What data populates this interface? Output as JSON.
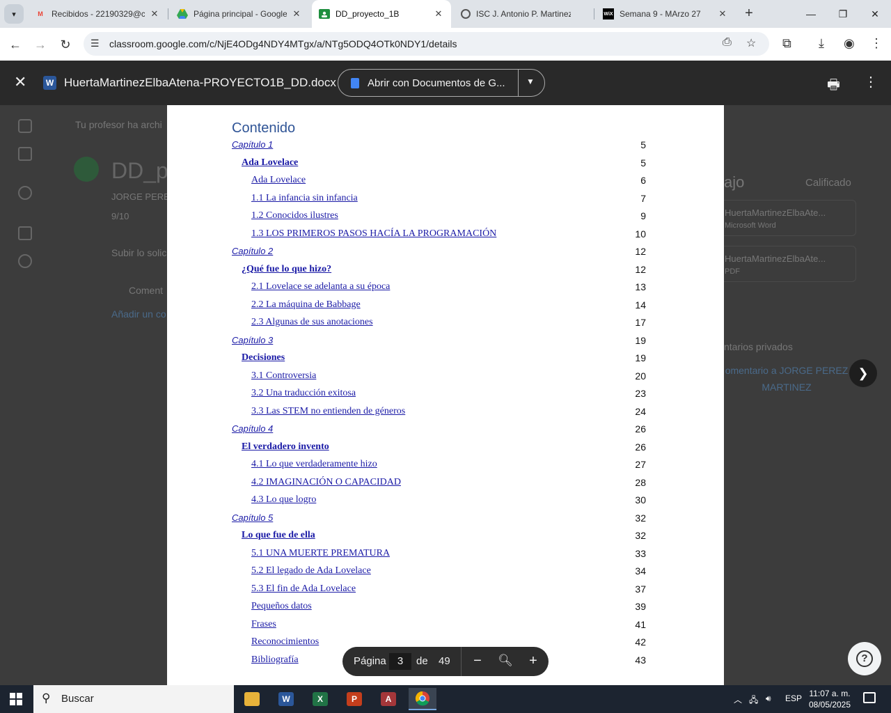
{
  "browser": {
    "tabs": [
      {
        "title": "Recibidos - 22190329@co",
        "icon": "gmail-icon"
      },
      {
        "title": "Página principal - Google",
        "icon": "drive-icon"
      },
      {
        "title": "DD_proyecto_1B",
        "icon": "classroom-icon",
        "active": true
      },
      {
        "title": "ISC J. Antonio P. Martinez",
        "icon": "globe-icon"
      },
      {
        "title": "Semana 9 - MArzo 27",
        "icon": "wix-icon"
      }
    ],
    "url": "classroom.google.com/c/NjE4ODg4NDY4MTgx/a/NTg5ODQ4OTk0NDY1/details"
  },
  "background_page": {
    "notice": "Tu profesor ha archi",
    "assignment_title": "DD_pr",
    "teacher": "JORGE PERE",
    "grade": "9/10",
    "upload_hint": "Subir lo solic",
    "comments_label": "Coment",
    "add_comment": "Añadir un co",
    "work_heading": "ajo",
    "graded_status": "Calificado",
    "files": [
      {
        "name": "HuertaMartinezElbaAte...",
        "type": "Microsoft Word"
      },
      {
        "name": "HuertaMartinezElbaAte...",
        "type": "PDF"
      }
    ],
    "private_comments": "ntarios privados",
    "private_comment_link": "omentario a JORGE PEREZ MARTINEZ"
  },
  "viewer": {
    "filename": "HuertaMartinezElbaAtena-PROYECTO1B_DD.docx",
    "open_with": "Abrir con Documentos de G...",
    "file_icon_letter": "W"
  },
  "document": {
    "toc_title": "Contenido",
    "entries": [
      {
        "text": "Capítulo 1",
        "page": "5",
        "level": "chap"
      },
      {
        "text": "Ada Lovelace",
        "page": "5",
        "level": "title"
      },
      {
        "text": "Ada Lovelace",
        "page": "6",
        "level": "sub"
      },
      {
        "text": "1.1 La infancia sin infancia",
        "page": "7",
        "level": "sub"
      },
      {
        "text": "1.2 Conocidos ilustres",
        "page": "9",
        "level": "sub"
      },
      {
        "text": "1.3 LOS PRIMEROS PASOS HACÍA LA PROGRAMACIÓN",
        "page": "10",
        "level": "sub"
      },
      {
        "text": "Capítulo 2",
        "page": "12",
        "level": "chap"
      },
      {
        "text": "¿Qué fue lo que hizo?",
        "page": "12",
        "level": "title"
      },
      {
        "text": "2.1 Lovelace se adelanta a su época",
        "page": "13",
        "level": "sub"
      },
      {
        "text": "2.2 La máquina de Babbage",
        "page": "14",
        "level": "sub"
      },
      {
        "text": "2.3 Algunas de sus anotaciones",
        "page": "17",
        "level": "sub"
      },
      {
        "text": "Capítulo 3",
        "page": "19",
        "level": "chap"
      },
      {
        "text": "Decisiones",
        "page": "19",
        "level": "title"
      },
      {
        "text": "3.1 Controversia",
        "page": "20",
        "level": "sub"
      },
      {
        "text": "3.2 Una traducción exitosa",
        "page": "23",
        "level": "sub"
      },
      {
        "text": "3.3 Las STEM no entienden de géneros",
        "page": "24",
        "level": "sub"
      },
      {
        "text": "Capítulo 4",
        "page": "26",
        "level": "chap"
      },
      {
        "text": "El verdadero invento",
        "page": "26",
        "level": "title"
      },
      {
        "text": "4.1 Lo que verdaderamente hizo",
        "page": "27",
        "level": "sub"
      },
      {
        "text": "4.2 IMAGINACIÓN O CAPACIDAD",
        "page": "28",
        "level": "sub"
      },
      {
        "text": "4.3 Lo que logro",
        "page": "30",
        "level": "sub"
      },
      {
        "text": "Capítulo 5",
        "page": "32",
        "level": "chap"
      },
      {
        "text": "Lo que fue de ella",
        "page": "32",
        "level": "title"
      },
      {
        "text": "5.1 UNA MUERTE PREMATURA",
        "page": "33",
        "level": "sub"
      },
      {
        "text": "5.2 El legado de Ada Lovelace",
        "page": "34",
        "level": "sub"
      },
      {
        "text": "5.3 El fin de Ada Lovelace",
        "page": "37",
        "level": "sub"
      },
      {
        "text": "Pequeños datos",
        "page": "39",
        "level": "sub"
      },
      {
        "text": "Frases",
        "page": "41",
        "level": "sub"
      },
      {
        "text": "Reconocimientos",
        "page": "42",
        "level": "sub"
      },
      {
        "text": "Bibliografía",
        "page": "43",
        "level": "sub"
      }
    ]
  },
  "pager": {
    "label": "Página",
    "current": "3",
    "of": "de",
    "total": "49"
  },
  "taskbar": {
    "search_placeholder": "Buscar",
    "language": "ESP",
    "time": "11:07 a. m.",
    "date": "08/05/2025",
    "notification_count": "1"
  },
  "colors": {
    "toc_heading": "#2f5496",
    "link": "#1a1aa6",
    "viewer_bg": "#4a4a4a"
  }
}
